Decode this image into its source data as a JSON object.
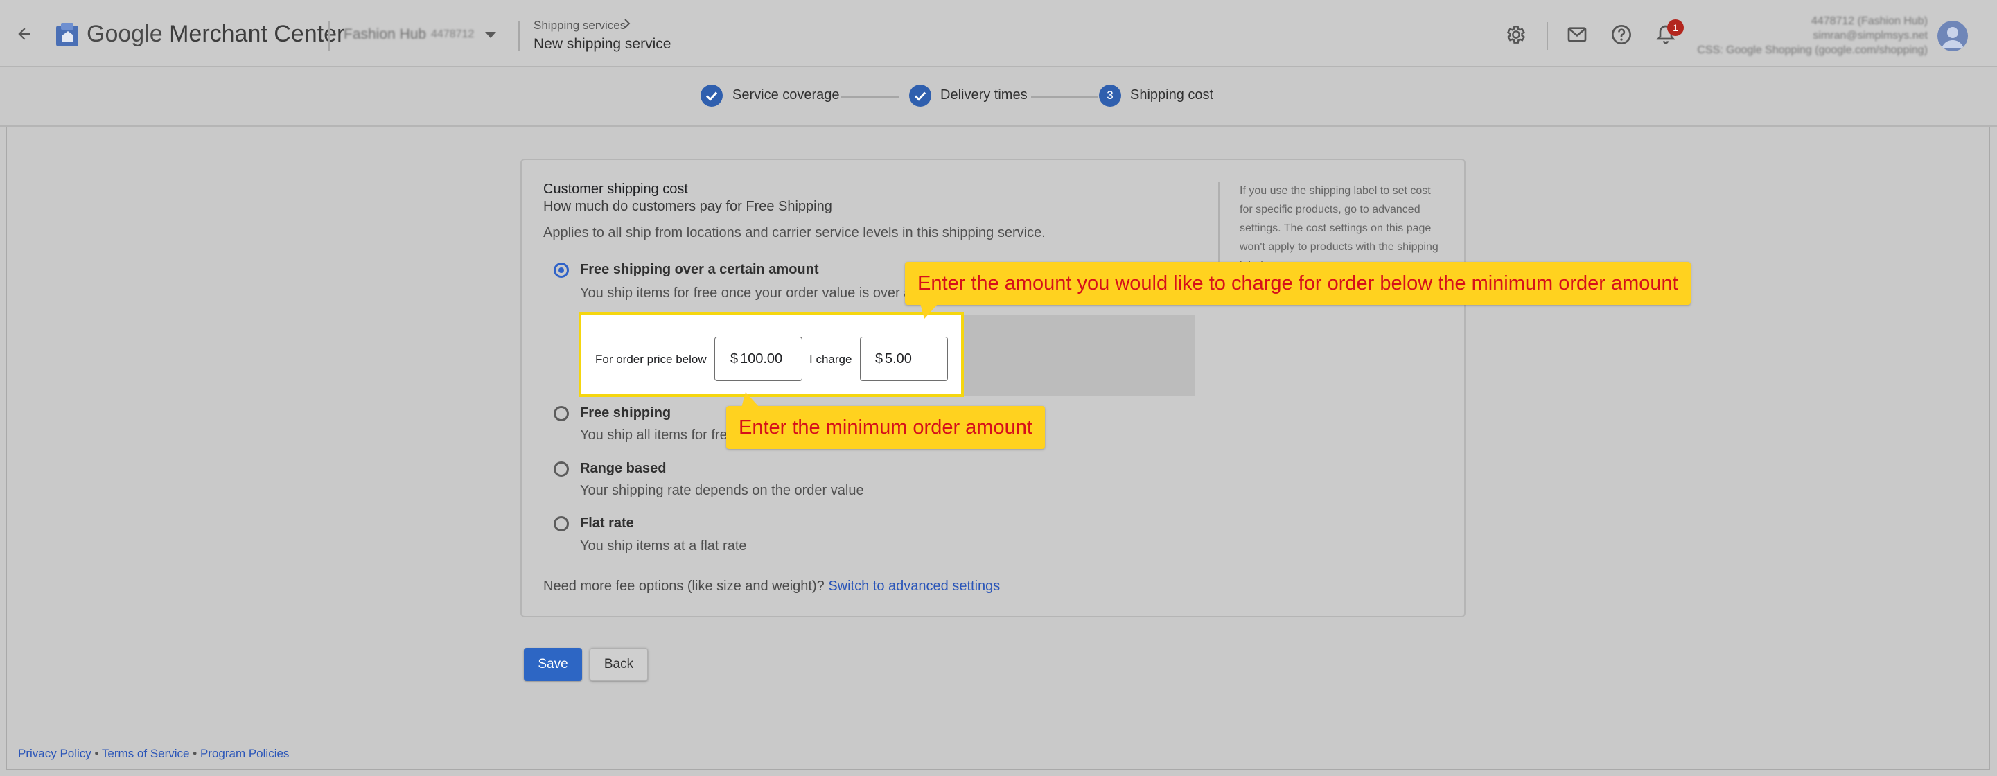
{
  "header": {
    "app_name_part1": "Google",
    "app_name_part2": "Merchant Center",
    "account_name": "Fashion Hub",
    "account_id": "4478712",
    "breadcrumb_parent": "Shipping services",
    "page_title": "New shipping service",
    "notification_count": "1",
    "user_lines": [
      "4478712 (Fashion Hub)",
      "simran@simplmsys.net",
      "CSS: Google Shopping (google.com/shopping)"
    ]
  },
  "stepper": {
    "steps": [
      {
        "label": "Service coverage",
        "state": "done"
      },
      {
        "label": "Delivery times",
        "state": "done"
      },
      {
        "label": "Shipping cost",
        "state": "current",
        "number": "3"
      }
    ]
  },
  "card": {
    "title": "Customer shipping cost",
    "subtitle": "How much do customers pay for Free Shipping",
    "description": "Applies to all ship from locations and carrier service levels in this shipping service.",
    "side_note": "If you use the shipping label to set cost for specific products, go to advanced settings. The cost settings on this page won't apply to products with the shipping label.",
    "options": [
      {
        "title": "Free shipping over a certain amount",
        "desc": "You ship items for free once your order value is over a",
        "selected": true
      },
      {
        "title": "Free shipping",
        "desc": "You ship all items for free",
        "selected": false
      },
      {
        "title": "Range based",
        "desc": "Your shipping rate depends on the order value",
        "selected": false
      },
      {
        "title": "Flat rate",
        "desc": "You ship items at a flat rate",
        "selected": false
      }
    ],
    "min_order": {
      "label": "For order price below",
      "currency": "$",
      "value": "100.00",
      "charge_label": "I charge",
      "charge_currency": "$",
      "charge_value": "5.00"
    },
    "more_fee_text": "Need more fee options (like size and weight)?",
    "more_fee_link": "Switch to advanced settings"
  },
  "actions": {
    "save_label": "Save",
    "back_label": "Back"
  },
  "footer": {
    "privacy": "Privacy Policy",
    "terms": "Terms of Service",
    "program": "Program Policies",
    "separator": "•"
  },
  "callouts": {
    "top": "Enter the amount you would like to charge for order below the minimum order amount",
    "bottom": "Enter the minimum order amount"
  },
  "colors": {
    "accent": "#2f62c8",
    "callout_bg": "#ffd21f",
    "callout_text": "#d6101a",
    "highlight_border": "#f5d60f"
  }
}
